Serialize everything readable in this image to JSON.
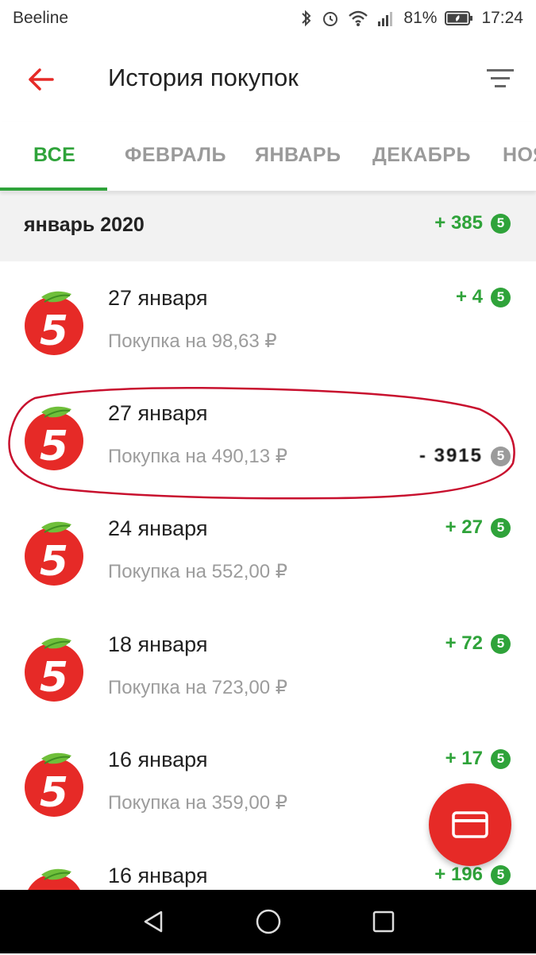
{
  "status": {
    "carrier": "Beeline",
    "battery": "81%",
    "time": "17:24"
  },
  "header": {
    "title": "История покупок",
    "back_icon": "back-arrow-icon",
    "filter_icon": "filter-icon"
  },
  "tabs": [
    {
      "label": "ВСЕ",
      "active": true
    },
    {
      "label": "ФЕВРАЛЬ",
      "active": false
    },
    {
      "label": "ЯНВАРЬ",
      "active": false
    },
    {
      "label": "ДЕКАБРЬ",
      "active": false
    },
    {
      "label": "НОЯ",
      "active": false
    }
  ],
  "month": {
    "label": "январь 2020",
    "points": "+ 385",
    "coin": "5"
  },
  "purchases": [
    {
      "date": "27 января",
      "summary": "Покупка на 98,63 ₽",
      "points": "+ 4",
      "coin": "5"
    },
    {
      "date": "27 января",
      "summary": "Покупка на 490,13 ₽",
      "points": "- 3915",
      "coin": "5"
    },
    {
      "date": "24 января",
      "summary": "Покупка на 552,00 ₽",
      "points": "+ 27",
      "coin": "5"
    },
    {
      "date": "18 января",
      "summary": "Покупка на 723,00 ₽",
      "points": "+ 72",
      "coin": "5"
    },
    {
      "date": "16 января",
      "summary": "Покупка на 359,00 ₽",
      "points": "+ 17",
      "coin": "5"
    },
    {
      "date": "16 января",
      "summary": "",
      "points": "+ 196",
      "coin": "5"
    }
  ],
  "colors": {
    "accent_green": "#2fa33a",
    "brand_red": "#e62a27",
    "annotation_red": "#c8102e"
  }
}
